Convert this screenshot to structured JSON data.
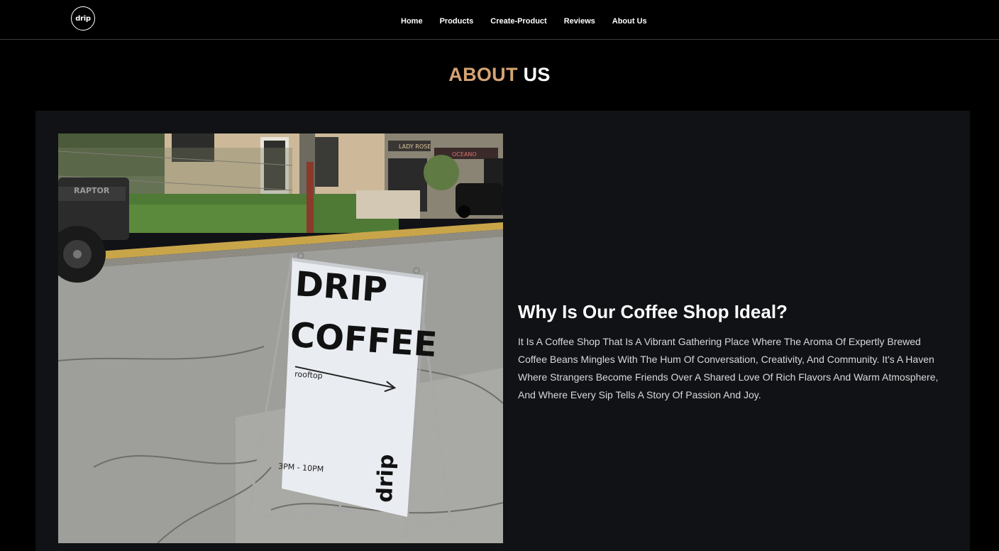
{
  "nav": {
    "logo_text": "drip",
    "links": [
      "Home",
      "Products",
      "Create-Product",
      "Reviews",
      "About Us"
    ]
  },
  "about": {
    "title_accent": "ABOUT",
    "title_rest": "US",
    "heading": "Why Is Our Coffee Shop Ideal?",
    "body": "It Is A Coffee Shop That Is A Vibrant Gathering Place Where The Aroma Of Expertly Brewed Coffee Beans Mingles With The Hum Of Conversation, Creativity, And Community. It's A Haven Where Strangers Become Friends Over A Shared Love Of Rich Flavors And Warm Atmosphere, And Where Every Sip Tells A Story Of Passion And Joy."
  },
  "photo": {
    "sign_line1": "DRIP",
    "sign_line2": "COFFEE",
    "sign_sub": "rooftop",
    "sign_hours": "3PM - 10PM",
    "sign_logo": "drip",
    "truck_badge": "RAPTOR",
    "storefront_1": "LADY ROSE",
    "storefront_2": "OCEANO"
  },
  "colors": {
    "accent": "#d4a373",
    "background": "#000000",
    "panel": "#111216"
  }
}
